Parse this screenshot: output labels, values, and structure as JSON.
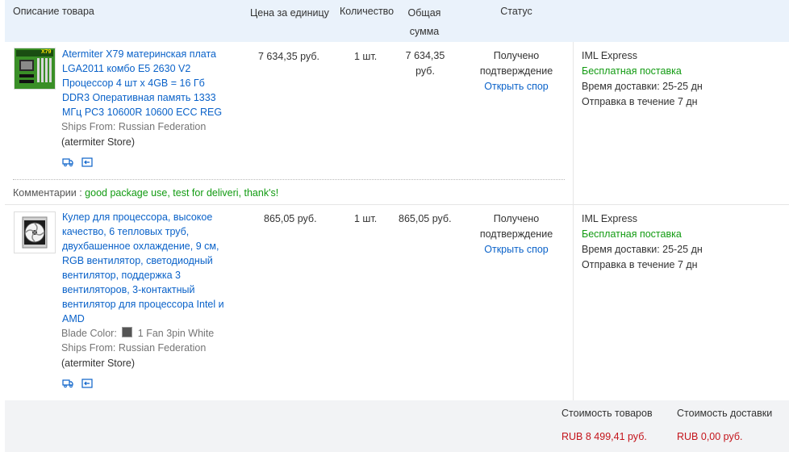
{
  "header": {
    "description": "Описание товара",
    "unit_price": "Цена за единицу",
    "quantity": "Количество",
    "total_line1": "Общая",
    "total_line2": "сумма",
    "status": "Статус"
  },
  "items": [
    {
      "title_lines": [
        "Atermiter X79 материнская плата",
        "LGA2011 комбо E5 2630 V2",
        "Процессор 4 шт x 4GB = 16 Гб",
        "DDR3 Оперативная память 1333",
        "МГц PC3 10600R 10600 ECC REG"
      ],
      "ships_label": "Ships From:",
      "ships_value": "Russian Federation",
      "store": "(atermiter Store)",
      "price": "7 634,35 руб.",
      "qty": "1 шт.",
      "total_line1": "7 634,35",
      "total_line2": "руб.",
      "status_line1": "Получено",
      "status_line2": "подтверждение",
      "dispute": "Открыть спор",
      "carrier": "IML Express",
      "free_shipping": "Бесплатная поставка",
      "delivery_time": "Время доставки:  25-25 дн",
      "dispatch": "Отправка в течение  7 дн",
      "thumb_badge": "X79"
    },
    {
      "title_lines": [
        "Кулер для процессора, высокое",
        "качество, 6 тепловых труб,",
        "двухбашенное охлаждение, 9 см,",
        "RGB вентилятор, светодиодный",
        "вентилятор, поддержка 3",
        "вентиляторов, 3-контактный",
        "вентилятор для процессора Intel и",
        "AMD"
      ],
      "color_label": "Blade Color:",
      "color_value": "1 Fan 3pin White",
      "ships_label": "Ships From:",
      "ships_value": "Russian Federation",
      "store": "(atermiter Store)",
      "price": "865,05 руб.",
      "qty": "1 шт.",
      "total": "865,05 руб.",
      "status_line1": "Получено",
      "status_line2": "подтверждение",
      "dispute": "Открыть спор",
      "carrier": "IML Express",
      "free_shipping": "Бесплатная поставка",
      "delivery_time": "Время доставки:  25-25 дн",
      "dispatch": "Отправка в течение  7 дн"
    }
  ],
  "comment": {
    "label": "Комментарии :",
    "text": "good package use, test for deliveri, thank's!"
  },
  "footer": {
    "goods_cost_label": "Стоимость товаров",
    "goods_cost_value": "RUB 8 499,41 руб.",
    "shipping_cost_label": "Стоимость доставки",
    "shipping_cost_value": "RUB 0,00 руб."
  },
  "icons": [
    "truck-icon",
    "return-icon",
    "blade-color-swatch-icon"
  ],
  "colors": {
    "link": "#0a62c9",
    "free_shipping": "#129b12",
    "price_red": "#c4141b",
    "header_bg": "#eaf2fb"
  }
}
